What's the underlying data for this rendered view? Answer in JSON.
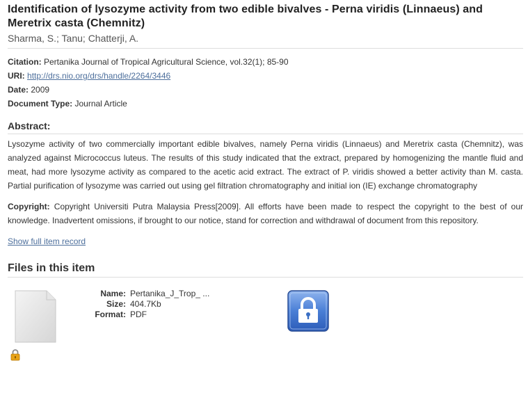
{
  "item": {
    "title": "Identification of lysozyme activity from two edible bivalves - Perna viridis (Linnaeus) and Meretrix casta (Chemnitz)",
    "authors": "Sharma, S.; Tanu; Chatterji, A."
  },
  "fields": {
    "citation_label": "Citation:",
    "citation": "Pertanika Journal of Tropical Agricultural Science, vol.32(1); 85-90",
    "uri_label": "URI:",
    "uri": "http://drs.nio.org/drs/handle/2264/3446",
    "date_label": "Date:",
    "date": "2009",
    "doctype_label": "Document Type:",
    "doctype": "Journal Article"
  },
  "abstract": {
    "heading": "Abstract:",
    "text": "Lysozyme activity of two commercially important edible bivalves, namely Perna viridis (Linnaeus) and Meretrix casta (Chemnitz), was analyzed against Micrococcus luteus. The results of this study indicated that the extract, prepared by homogenizing the mantle fluid and meat, had more lysozyme activity as compared to the acetic acid extract. The extract of P. viridis showed a better activity than M. casta. Partial purification of lysozyme was carried out using gel filtration chromatography and initial ion (IE) exchange chromatography"
  },
  "copyright": {
    "label": "Copyright:",
    "text": "Copyright Universiti Putra Malaysia Press[2009]. All efforts have been made to respect the copyright to the best of our knowledge. Inadvertent omissions, if brought to our notice, stand for correction and withdrawal of document from this repository."
  },
  "show_full_record": "Show full item record",
  "files": {
    "heading": "Files in this item",
    "name_label": "Name:",
    "name": "Pertanika_J_Trop_ ...",
    "size_label": "Size:",
    "size": "404.7Kb",
    "format_label": "Format:",
    "format": "PDF",
    "icons": {
      "thumbnail": "document-thumbnail-icon",
      "restricted": "lock-icon",
      "access": "padlock-access-icon"
    }
  },
  "colors": {
    "link": "#4d6f9c",
    "lock_blue": "#3b6fc4"
  }
}
